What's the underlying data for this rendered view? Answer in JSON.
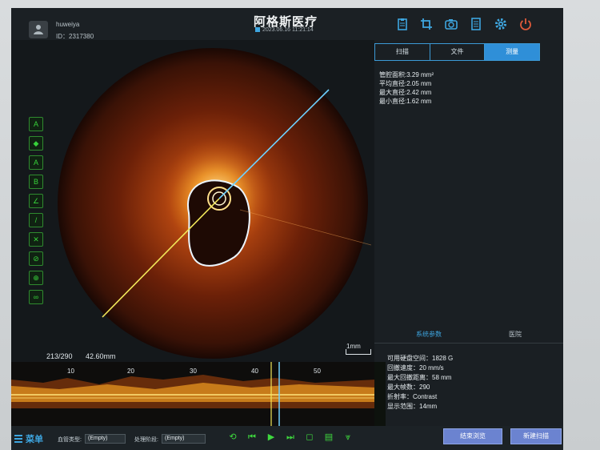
{
  "header": {
    "user_name": "huweiya",
    "user_id": "ID：2317380",
    "title": "阿格斯医疗",
    "datetime": "2023.06.16  11:21:14",
    "icons": [
      "clipboard-icon",
      "crop-icon",
      "camera-icon",
      "document-icon",
      "gear-icon",
      "power-icon"
    ]
  },
  "toolbar": {
    "tools": [
      {
        "name": "area-measure-tool",
        "glyph": "A"
      },
      {
        "name": "auto-contour-tool",
        "glyph": "◆"
      },
      {
        "name": "point-distance-tool",
        "glyph": "A"
      },
      {
        "name": "segment-tool",
        "glyph": "B"
      },
      {
        "name": "angle-tool",
        "glyph": "∠"
      },
      {
        "name": "line-tool",
        "glyph": "/"
      },
      {
        "name": "delete-tool",
        "glyph": "✕"
      },
      {
        "name": "hide-tool",
        "glyph": "⊘"
      },
      {
        "name": "zoom-tool",
        "glyph": "⊕"
      },
      {
        "name": "link-tool",
        "glyph": "∞"
      }
    ]
  },
  "image": {
    "frame": "213/290",
    "pullback": "42.60mm",
    "scale_label": "1mm"
  },
  "right_panel": {
    "tabs": [
      "扫描",
      "文件",
      "测量"
    ],
    "active_tab": "测量",
    "measurements": {
      "lumen_area": "管腔面积:3.29 mm²",
      "mean_diameter": "平均直径:2.05 mm",
      "max_diameter": "最大直径:2.42 mm",
      "min_diameter": "最小直径:1.62 mm"
    },
    "sub_tabs": [
      "系统参数",
      "医院"
    ],
    "params": {
      "disk_space": "可用硬盘空间：1828 G",
      "pullback_speed": "回撤速度：20 mm/s",
      "max_pullback_distance": "最大回撤距离：58 mm",
      "max_frames": "最大帧数：290",
      "refractive_index": "折射率：Contrast",
      "display_range": "显示范围：14mm"
    }
  },
  "longitudinal": {
    "scale_marks": [
      "10",
      "20",
      "30",
      "40",
      "50"
    ]
  },
  "bottombar": {
    "menu_label": "菜单",
    "vessel_type_label": "血管类型:",
    "vessel_type_value": "(Empty)",
    "stage_label": "处理阶段:",
    "stage_value": "(Empty)",
    "end_browse_label": "结束浏览",
    "new_scan_label": "新建扫描"
  },
  "colors": {
    "accent": "#2f8fd8",
    "tool_green": "#37d23a",
    "contour": "#e9f6ff",
    "guide_line": "#6fd1ff"
  }
}
